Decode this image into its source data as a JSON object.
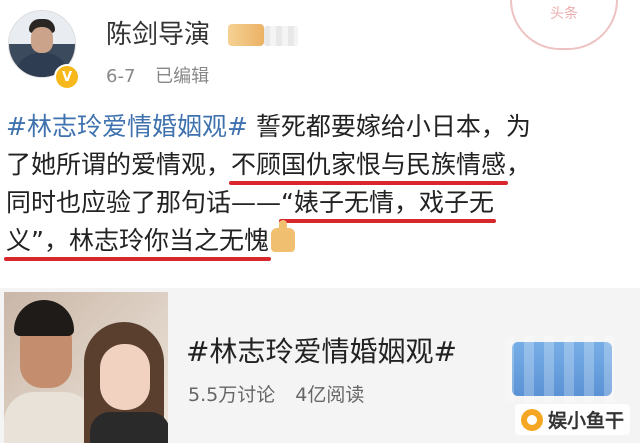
{
  "header": {
    "username": "陈剑导演",
    "verified_badge": "V",
    "date": "6-7",
    "edited": "已编辑",
    "stamp_text": "头条"
  },
  "post": {
    "line1_tag": "#林志玲爱情婚姻观#",
    "line1_text": " 誓死都要嫁给小日本，为",
    "line2_pre": "了她所谓的爱情观，",
    "line2_ul": "不顾国仇家恨与民族情感",
    "line2_post": "，",
    "line3_pre": "同时也应验了那句话——",
    "line3_ul": "“婊子无情，戏子无",
    "line4_ul": "义”，林志玲你当之无愧",
    "emoji": "thumbs-up"
  },
  "topic_card": {
    "title": "#林志玲爱情婚姻观#",
    "discussions": "5.5万讨论",
    "reads": "4亿阅读"
  },
  "watermark": {
    "text": "娱小鱼干"
  },
  "colors": {
    "tag": "#3f72ae",
    "underline": "#d7262c",
    "badge": "#f6b81a",
    "card_bg": "#f4f4f4"
  }
}
